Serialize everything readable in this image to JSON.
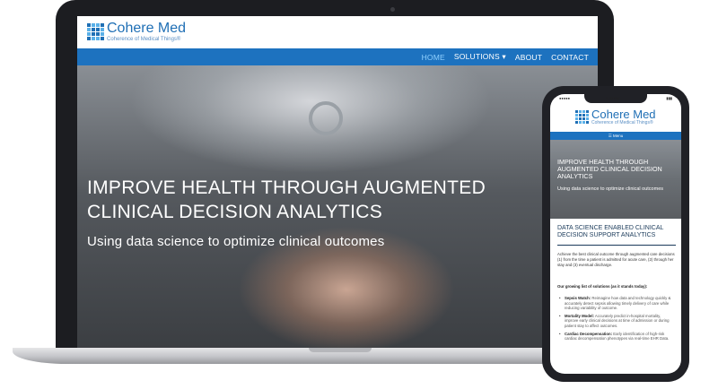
{
  "laptop": {
    "logo": {
      "name": "Cohere Med",
      "tagline": "Coherence of Medical Things®"
    },
    "nav": {
      "items": [
        "HOME",
        "SOLUTIONS ▾",
        "ABOUT",
        "CONTACT"
      ]
    },
    "hero": {
      "title": "IMPROVE HEALTH THROUGH AUGMENTED CLINICAL DECISION ANALYTICS",
      "subtitle": "Using data science to optimize clinical outcomes"
    }
  },
  "phone": {
    "status": {
      "left": "●●●●●",
      "time": "1:20 PM",
      "right": "▮▮▮"
    },
    "logo": {
      "name": "Cohere Med",
      "tagline": "Coherence of Medical Things®"
    },
    "menu_label": "☰ Menu",
    "hero": {
      "title": "IMPROVE HEALTH THROUGH AUGMENTED CLINICAL DECISION ANALYTICS",
      "subtitle": "Using data science to optimize clinical outcomes"
    },
    "section_title": "DATA SCIENCE ENABLED CLINICAL DECISION SUPPORT ANALYTICS",
    "intro": "Achieve the best clinical outcome through augmented care decisions (1) from the time a patient is admitted for acute care, (2) through her stay and (3) eventual discharge.",
    "list_heading": "Our growing list of solutions (as it stands today):",
    "solutions": [
      {
        "name": "Sepsis Watch:",
        "desc": " Reimagine how data and technology quickly & accurately detect sepsis allowing timely delivery of care while reducing variability of outcome."
      },
      {
        "name": "Mortality Model:",
        "desc": " Accurately predict in-hospital mortality, improve early clinical decisions at time of admission or during patient stay to affect outcomes."
      },
      {
        "name": "Cardiac Decompensation:",
        "desc": " Early identification of high-risk cardiac decompensation phenotypes via real-time EHR Data."
      }
    ]
  }
}
